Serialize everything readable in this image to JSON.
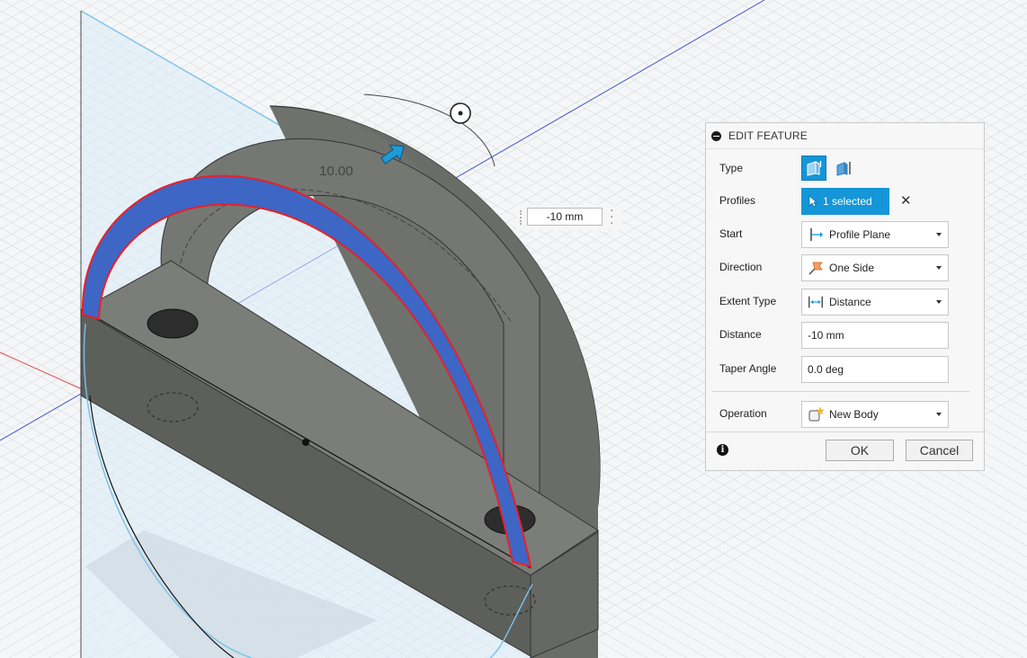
{
  "viewport": {
    "dimension_label": "10.00",
    "inline_distance_value": "-10 mm"
  },
  "panel": {
    "title": "EDIT FEATURE",
    "rows": {
      "type": {
        "label": "Type"
      },
      "profiles": {
        "label": "Profiles",
        "value": "1 selected"
      },
      "start": {
        "label": "Start",
        "value": "Profile Plane"
      },
      "direction": {
        "label": "Direction",
        "value": "One Side"
      },
      "extent_type": {
        "label": "Extent Type",
        "value": "Distance"
      },
      "distance": {
        "label": "Distance",
        "value": "-10 mm"
      },
      "taper_angle": {
        "label": "Taper Angle",
        "value": "0.0 deg"
      },
      "operation": {
        "label": "Operation",
        "value": "New Body"
      }
    },
    "buttons": {
      "ok": "OK",
      "cancel": "Cancel"
    }
  },
  "icons": {
    "collapse": "collapse-icon",
    "type_solid": "extrude-solid-icon",
    "type_thin": "extrude-thin-icon",
    "pointer": "cursor-pointer-icon",
    "clear": "close-icon",
    "start": "profile-plane-icon",
    "direction": "one-side-icon",
    "extent": "distance-icon",
    "operation": "new-body-icon",
    "info": "info-icon",
    "manipulator": "extrude-arrow-icon",
    "rotate_handle": "taper-handle-icon"
  },
  "colors": {
    "accent": "#1596d8",
    "profile_fill": "#3d66c5",
    "profile_outline": "#e8202a",
    "body": "#6f716d",
    "sketch_plane": "#d7eaf6",
    "plane_edge": "#7ac1ea"
  }
}
